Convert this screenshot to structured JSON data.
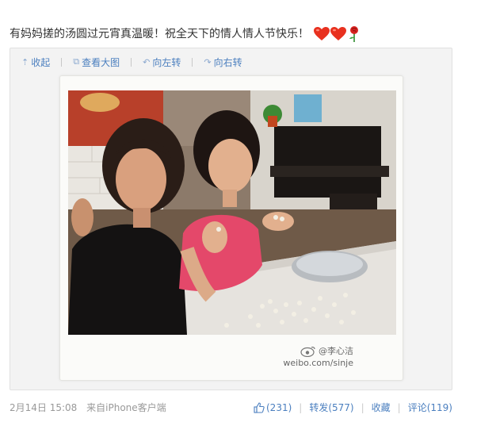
{
  "post": {
    "text": "有妈妈搓的汤圆过元宵真温暖！祝全天下的情人情人节快乐！",
    "emojis": [
      "heart-emoji",
      "heart-emoji",
      "rose-emoji"
    ]
  },
  "toolbar": {
    "items": [
      {
        "icon": "collapse-up-icon",
        "label": "收起"
      },
      {
        "icon": "view-large-icon",
        "label": "查看大图"
      },
      {
        "icon": "rotate-left-icon",
        "label": "向左转"
      },
      {
        "icon": "rotate-right-icon",
        "label": "向右转"
      }
    ]
  },
  "watermark": {
    "user": "@李心洁",
    "url": "weibo.com/sinje"
  },
  "footer": {
    "time": "2月14日 15:08",
    "source_prefix": "来自",
    "source": "iPhone客户端",
    "like_count": "(231)",
    "repost_label": "转发(577)",
    "favorite_label": "收藏",
    "comment_label": "评论(119)"
  },
  "colors": {
    "link": "#4b7fbf",
    "muted": "#999999",
    "heart": "#e8311f",
    "rose": "#d8231f"
  }
}
